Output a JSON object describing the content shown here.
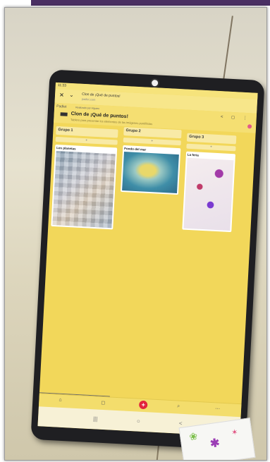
{
  "status": {
    "time": "11:33"
  },
  "app_header": {
    "close_label": "✕",
    "chevron_label": "⌄",
    "title": "Clon de ¡Qué de puntos!",
    "subtitle": "padlet.com"
  },
  "pad": {
    "brand": "Padlet",
    "by_line": "Realizado por Alguien",
    "title": "Clon de ¡Qué de puntos!",
    "description": "Tablero para presentar los elementos de las imágenes puntillistas",
    "header_icons": "< ◻ ⋮"
  },
  "columns": [
    {
      "header": "Grupo 1",
      "add": "+",
      "card_title": "Los planetas"
    },
    {
      "header": "Grupo 2",
      "add": "+",
      "card_title": "Fondo del mar"
    },
    {
      "header": "Grupo 3",
      "add": "+",
      "card_title": "La feria"
    }
  ],
  "bottom_bar": {
    "plus": "+",
    "left_icon": "⌂",
    "mid_icon": "◻",
    "search_icon": "⌕",
    "more_icon": "⋯"
  },
  "nav_bar": {
    "recents": "|||",
    "home": "○",
    "back": "<"
  }
}
